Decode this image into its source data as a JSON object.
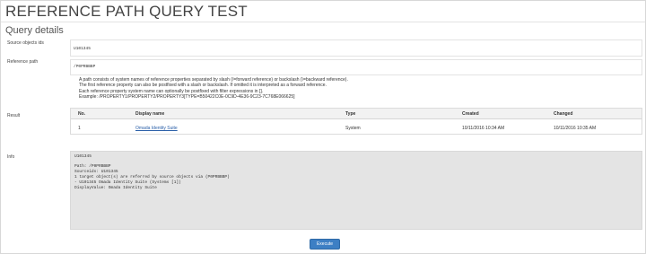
{
  "page": {
    "title": "REFERENCE PATH QUERY TEST",
    "section_title": "Query details"
  },
  "fields": {
    "source_objects": {
      "label": "Source objects ids",
      "value": "U101345"
    },
    "reference_path": {
      "label": "Reference path",
      "value": "/P0PRBBBP"
    }
  },
  "help": [
    "A path consists of system names of reference properties separated by slash (/=forward reference) or backslash (\\=backward reference).",
    "The first reference property can also be postfixed with a slash or backslash. If omitted it is interpreted as a forward reference.",
    "Each reference property system name can optionally be postfixed with filter expressions in [].",
    "Example: /PROPERTY1/PROPERTY2/PROPERTY3[TYPE=B50422C0E-0C9D-4E36-9C23-7C768E066625]"
  ],
  "result": {
    "label": "Result",
    "columns": [
      "No.",
      "Display name",
      "Type",
      "Created",
      "Changed"
    ],
    "rows": [
      {
        "no": "1",
        "display_name": "Omada Identity Suite",
        "type": "System",
        "created": "10/11/2016 10:34 AM",
        "changed": "10/11/2016 10:35 AM"
      }
    ]
  },
  "info": {
    "label": "Info",
    "first_line": "U101345",
    "lines": [
      "Path: /P0PRBBBP",
      "Sourceids: U101345",
      "1 target object(s) are referred by source objects via (P0PRBBBP)",
      "- U101345 Omada Identity Suite (Systems [1])",
      "DisplayValue: Omada Identity Suite"
    ]
  },
  "execute_label": "Execute"
}
